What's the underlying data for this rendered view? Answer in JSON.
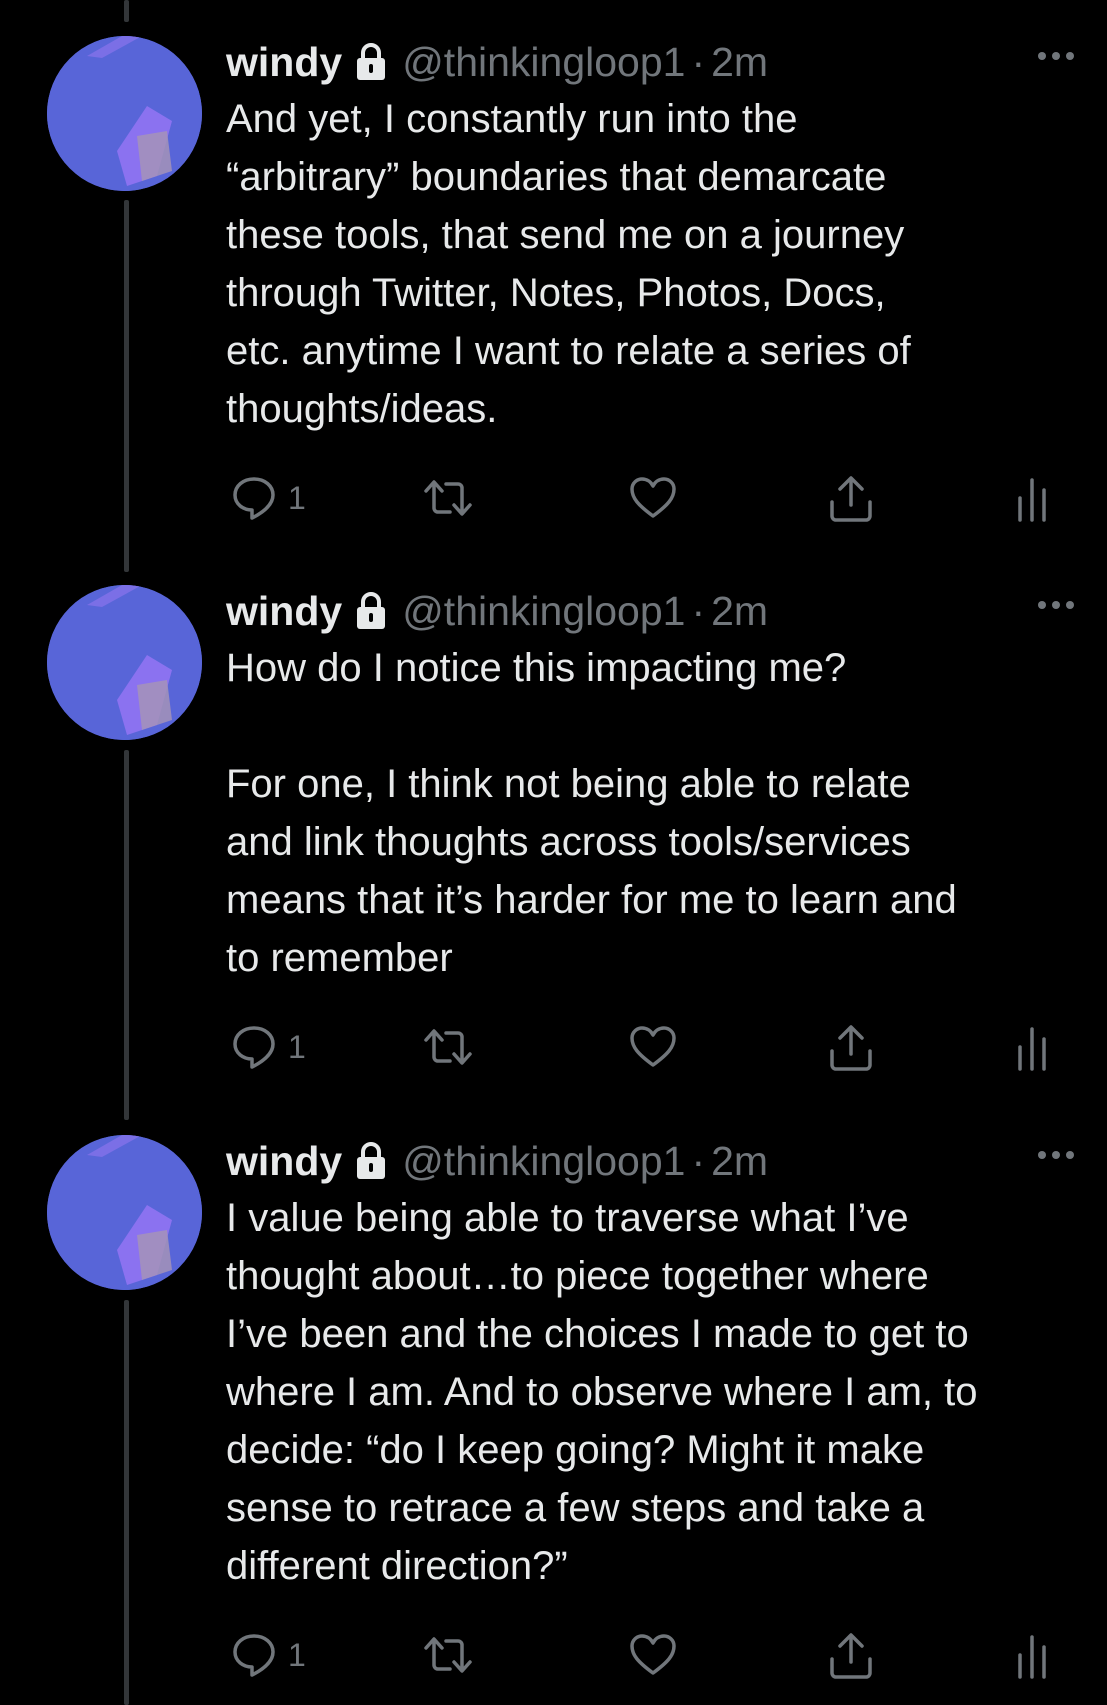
{
  "colors": {
    "background": "#000000",
    "text_primary": "#e7e9ea",
    "text_secondary": "#71767b",
    "thread_line": "#333639",
    "avatar_bg": "#5865d8"
  },
  "tweets": [
    {
      "name": "windy",
      "handle": "@thinkingloop1",
      "dot": "·",
      "time": "2m",
      "text": "And yet, I constantly run into the\n“arbitrary” boundaries that demarcate\nthese tools, that send me on a journey\nthrough Twitter, Notes, Photos, Docs,\netc. anytime I want to relate a series of\nthoughts/ideas.",
      "reply_count": "1",
      "icons": [
        "lock-icon",
        "more-icon",
        "reply-icon",
        "retweet-icon",
        "like-icon",
        "share-icon",
        "analytics-icon"
      ]
    },
    {
      "name": "windy",
      "handle": "@thinkingloop1",
      "dot": "·",
      "time": "2m",
      "text": "How do I notice this impacting me?\n\nFor one, I think not being able to relate\nand link thoughts across tools/services\nmeans that it’s harder for me to learn and\nto remember",
      "reply_count": "1",
      "icons": [
        "lock-icon",
        "more-icon",
        "reply-icon",
        "retweet-icon",
        "like-icon",
        "share-icon",
        "analytics-icon"
      ]
    },
    {
      "name": "windy",
      "handle": "@thinkingloop1",
      "dot": "·",
      "time": "2m",
      "text": "I value being able to traverse what I’ve\nthought about…to piece together where\nI’ve been and the choices I made to get to\nwhere I am. And to observe where I am, to\ndecide: “do I keep going? Might it make\nsense to retrace a few steps and take a\ndifferent direction?”",
      "reply_count": "1",
      "icons": [
        "lock-icon",
        "more-icon",
        "reply-icon",
        "retweet-icon",
        "like-icon",
        "share-icon",
        "analytics-icon"
      ]
    }
  ]
}
